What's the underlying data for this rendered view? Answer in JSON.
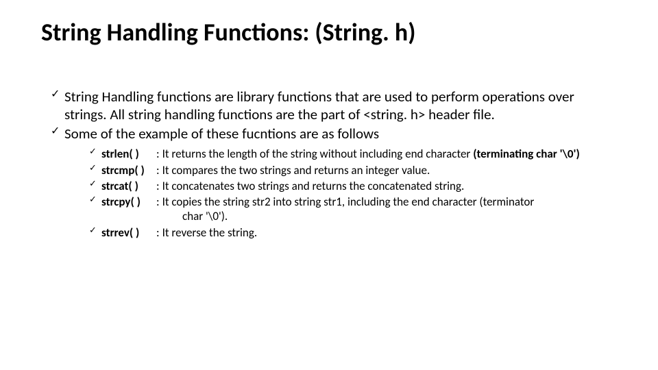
{
  "title": "String Handling Functions: (String. h)",
  "main_points": [
    "String Handling functions are library functions that are used to perform operations over strings. All string handling functions are the part of <string. h> header file.",
    "Some of the example of these fucntions are as follows"
  ],
  "functions": [
    {
      "name": "strlen( )",
      "desc_before": "It returns the length of the string without including end character ",
      "bold_tail": "(terminating char '\\0')",
      "desc_after": "",
      "extra_line": ""
    },
    {
      "name": "strcmp( )",
      "desc_before": "It compares the two strings and returns an integer value.",
      "bold_tail": "",
      "desc_after": "",
      "extra_line": ""
    },
    {
      "name": "strcat( )",
      "desc_before": "It concatenates two strings and returns the concatenated string.",
      "bold_tail": "",
      "desc_after": "",
      "extra_line": ""
    },
    {
      "name": "strcpy( )",
      "desc_before": "It copies the string str2 into string str1, including the end character (terminator",
      "bold_tail": "",
      "desc_after": "",
      "extra_line": "char '\\0')."
    },
    {
      "name": "strrev( )",
      "desc_before": "It reverse the string.",
      "bold_tail": "",
      "desc_after": "",
      "extra_line": ""
    }
  ]
}
